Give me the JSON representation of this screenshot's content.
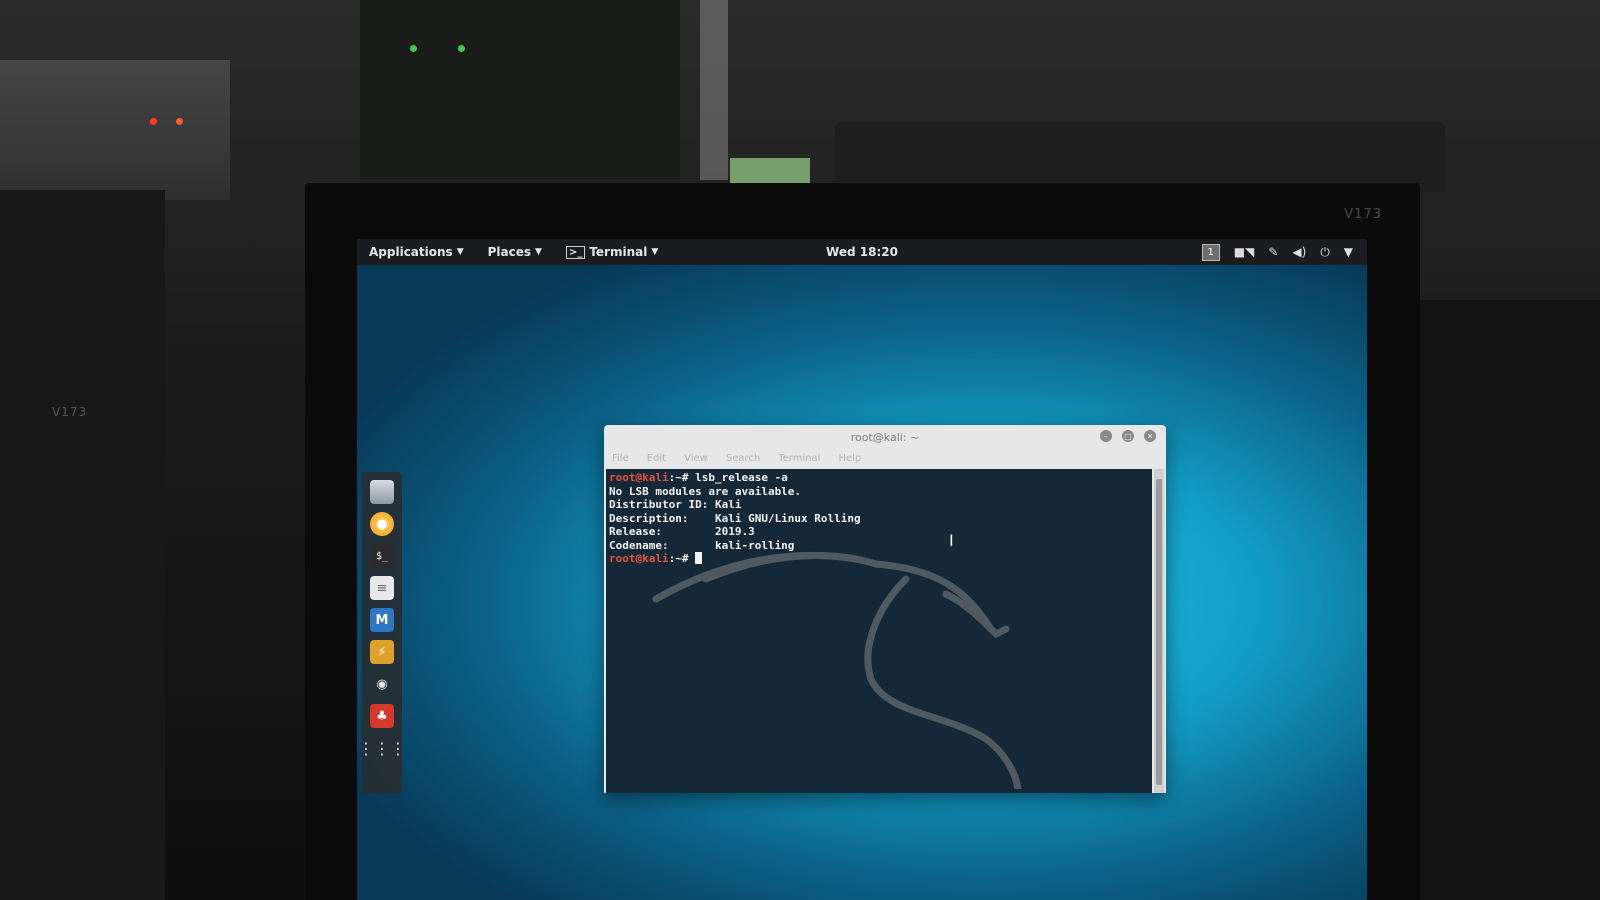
{
  "top_panel": {
    "applications_label": "Applications",
    "places_label": "Places",
    "terminal_label": "Terminal",
    "clock": "Wed 18:20",
    "workspace_number": "1"
  },
  "bezel": {
    "model_main": "V173",
    "model_left": "V173"
  },
  "terminal_window": {
    "title": "root@kali: ~",
    "menu": [
      "File",
      "Edit",
      "View",
      "Search",
      "Terminal",
      "Help"
    ],
    "lines": [
      {
        "user": "root@kali",
        "rest": ":~# lsb_release -a"
      },
      {
        "text": "No LSB modules are available."
      },
      {
        "text": "Distributor ID: Kali"
      },
      {
        "text": "Description:    Kali GNU/Linux Rolling"
      },
      {
        "text": "Release:        2019.3"
      },
      {
        "text": "Codename:       kali-rolling"
      },
      {
        "user": "root@kali",
        "rest": ":~# "
      }
    ]
  },
  "dock": {
    "icons": [
      "files-icon",
      "firefox-icon",
      "terminal-icon",
      "notes-icon",
      "metasploit-icon",
      "burpsuite-icon",
      "maltego-icon",
      "cherrytree-icon",
      "app-grid-icon"
    ]
  },
  "colors": {
    "desktop_center": "#1fc6e6",
    "desktop_edge": "#083a58",
    "panel_bg": "#1a1c1f",
    "terminal_bg": "#152837",
    "prompt_red": "#e8523c"
  }
}
